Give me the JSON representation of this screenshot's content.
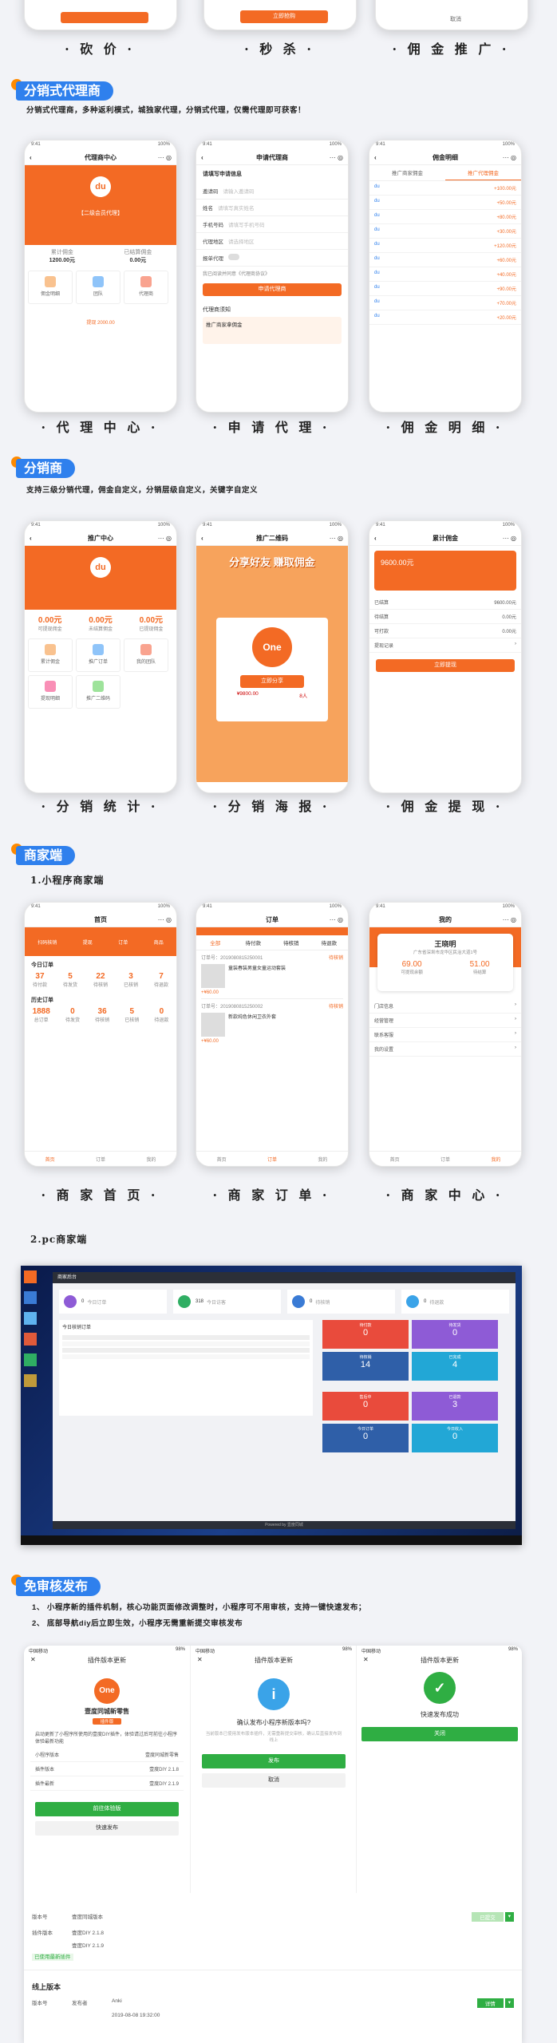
{
  "top_captions": [
    "· 砍 价 ·",
    "· 秒 杀 ·",
    "· 佣 金 推 广 ·"
  ],
  "top_phone_buttons": {
    "bargain": "",
    "seckill": "立即抢购",
    "commission": "取消"
  },
  "sections": {
    "agent": {
      "title": "分销式代理商",
      "desc": "分销式代理商，多种返利模式，城独家代理，分销式代理，仅需代理即可获客！"
    },
    "distribution": {
      "title": "分销商",
      "desc": "支持三级分销代理，佣金自定义，分销层级自定义，关键字自定义"
    },
    "merchant": {
      "title": "商家端",
      "sub1": "1.小程序商家端",
      "sub2": "2.pc商家端"
    },
    "release": {
      "title": "免审核发布",
      "desc1": "1、 小程序新的插件机制，核心功能页面修改调整时，小程序可不用审核，支持一键快速发布；",
      "desc2": "2、 底部导航diy后立即生效，小程序无需重新提交审核发布"
    }
  },
  "agent_phones": {
    "center": {
      "nav": "代理商中心",
      "level": "【二级会员代理】",
      "left_label": "累计佣金",
      "left_val": "1200.00元",
      "right_label": "已结算佣金",
      "right_val": "0.00元",
      "cells": [
        "佣金明细",
        "团队",
        "代理商"
      ],
      "bottom": "提现 2000.00"
    },
    "apply": {
      "nav": "申请代理商",
      "title": "请填写申请信息",
      "fields": [
        [
          "邀请码",
          "请输入邀请码"
        ],
        [
          "姓名",
          "请填写真实姓名"
        ],
        [
          "手机号码",
          "请填写手机号码"
        ],
        [
          "代理地区",
          "请选择地区"
        ],
        [
          "报单代理",
          ""
        ]
      ],
      "agree": "我已阅读并同意《代理商协议》",
      "button": "申请代理商",
      "notice": "代理商须知",
      "banner": "推广商家拿佣金"
    },
    "commission": {
      "nav": "佣金明细",
      "tabs": [
        "推广商家佣金",
        "推广代理佣金"
      ],
      "rows": [
        "+100.00元",
        "+50.00元",
        "+80.00元",
        "+30.00元",
        "+120.00元",
        "+60.00元",
        "+40.00元",
        "+90.00元",
        "+70.00元",
        "+20.00元"
      ]
    }
  },
  "agent_captions": [
    "· 代 理 中 心 ·",
    "· 申 请 代 理 ·",
    "· 佣 金 明 细 ·"
  ],
  "dist_phones": {
    "stats": {
      "nav": "推广中心",
      "labels": [
        "可提现佣金",
        "未结算佣金",
        "已提现佣金"
      ],
      "vals": [
        "0.00元",
        "0.00元",
        "0.00元"
      ],
      "cells": [
        "累计佣金",
        "推广订单",
        "我的团队",
        "提现明细",
        "推广二维码"
      ]
    },
    "poster": {
      "nav": "推广二维码",
      "headline": "分享好友 赚取佣金",
      "price1": "¥9800.00",
      "price2": "8人",
      "btn": "立即分享"
    },
    "withdraw": {
      "nav": "累计佣金",
      "amount": "9600.00元",
      "rows": [
        [
          "已结算",
          "9600.00元"
        ],
        [
          "待结算",
          "0.00元"
        ],
        [
          "可打款",
          "0.00元"
        ],
        [
          "提现记录",
          ""
        ]
      ],
      "btn": "立即提现"
    }
  },
  "dist_captions": [
    "· 分 销 统 计 ·",
    "· 分 销 海 报 ·",
    "· 佣 金 提 现 ·"
  ],
  "merchant_phones": {
    "home": {
      "nav": "首页",
      "icons": [
        "扫码核销",
        "提现",
        "订单",
        "商品"
      ],
      "today": "今日订单",
      "today_vals": [
        "37",
        "5",
        "22",
        "3",
        "7"
      ],
      "today_labels": [
        "待付款",
        "待发货",
        "待核销",
        "已核销",
        "待退款"
      ],
      "history": "历史订单",
      "hist_vals": [
        "1888",
        "0",
        "36",
        "5",
        "0"
      ],
      "hist_labels": [
        "总订单",
        "待发货",
        "待核销",
        "已核销",
        "待退款"
      ],
      "tabs": [
        "首页",
        "订单",
        "我的"
      ]
    },
    "orders": {
      "nav": "订单",
      "tabs": [
        "全部",
        "待付款",
        "待核销",
        "待退款"
      ],
      "items": [
        {
          "no": "订单号：2019080815250001",
          "status": "待核销",
          "name": "童装春装男童女童运动套装",
          "price": "+¥60.00"
        },
        {
          "no": "订单号：2019080815250002",
          "status": "待核销",
          "name": "新款纯色休闲卫衣外套",
          "price": "+¥60.00"
        }
      ],
      "total": "合计 ¥60.00",
      "tabbar": [
        "首页",
        "订单",
        "我的"
      ]
    },
    "center": {
      "nav": "我的",
      "name": "王晓明",
      "addr": "广东省深圳市龙华区民治大道1号",
      "bal1": "69.00",
      "bal1_label": "可提现余额",
      "bal2": "51.00",
      "bal2_label": "待结算",
      "menu": [
        "门店信息",
        "经营管理",
        "联系客服",
        "我的设置"
      ],
      "tabbar": [
        "首页",
        "订单",
        "我的"
      ]
    }
  },
  "merchant_captions": [
    "· 商 家 首 页 ·",
    "· 商 家 订 单 ·",
    "· 商 家 中 心 ·"
  ],
  "pc": {
    "brand": "商家后台",
    "stats": [
      "0",
      "318",
      "0",
      "0"
    ],
    "stat_labels": [
      "今日订单",
      "今日访客",
      "待核销",
      "待退款"
    ],
    "table_title": "今日核销订单",
    "tiles": [
      "0",
      "0",
      "14",
      "4",
      "0",
      "3",
      "0",
      "0"
    ],
    "tile_labels": [
      "待付款",
      "待发货",
      "待核销",
      "已完成",
      "售后中",
      "已退款",
      "今日订单",
      "今日收入"
    ],
    "footer": "Powered by 壹度同城"
  },
  "release_phones": {
    "one": {
      "nav": "插件版本更新",
      "brand": "壹度同城新零售",
      "badge": "插件版",
      "desc": "启动更新了小程序所使用的壹度DIY插件，体验请过后可前往小程序体验最新功能",
      "rows": [
        [
          "小程序版本",
          "壹度同城新零售"
        ],
        [
          "插件版本",
          "壹度DIY 2.1.8"
        ],
        [
          "插件最新",
          "壹度DIY 2.1.9"
        ]
      ],
      "btn1": "前往体验版",
      "btn2": "快速发布"
    },
    "two": {
      "nav": "插件版本更新",
      "question": "确认发布小程序新版本吗?",
      "sub": "当前版本已使用发布版本插件，无需重新提交审核，确认后直接发布到线上",
      "btn1": "发布",
      "btn2": "取消"
    },
    "three": {
      "nav": "插件版本更新",
      "msg": "快速发布成功",
      "btn": "关闭"
    }
  },
  "bottom_panel": {
    "label1": "版本号",
    "v1": "壹度同城版本",
    "label2": "插件版本",
    "v2": "壹度DIY 2.1.8",
    "v3": "壹度DIY 2.1.9",
    "tag": "已使用最新插件",
    "online_title": "线上版本",
    "label3": "版本号",
    "label4": "发布者",
    "author": "Anki",
    "time": "2019-08-08 19:32:00",
    "btn_green1": "已提交",
    "btn_green2": "详情"
  }
}
